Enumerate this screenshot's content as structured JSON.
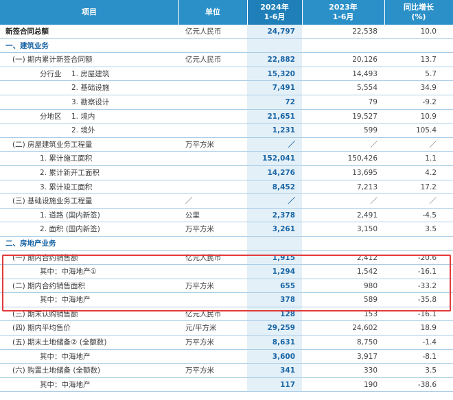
{
  "header": {
    "item": "项目",
    "unit": "单位",
    "y2024_line1": "2024年",
    "y2024_line2": "1-6月",
    "y2023_line1": "2023年",
    "y2023_line2": "1-6月",
    "yoy_line1": "同比增长",
    "yoy_line2": "(%)"
  },
  "rows": [
    {
      "label": "新签合同总额",
      "unit": "亿元人民币",
      "v2024": "24,797",
      "v2023": "22,538",
      "yoy": "10.0"
    },
    {
      "label": "一、建筑业务",
      "unit": "",
      "v2024": "",
      "v2023": "",
      "yoy": ""
    },
    {
      "label": "(一) 期内累计新签合同额",
      "unit": "亿元人民币",
      "v2024": "22,882",
      "v2023": "20,126",
      "yoy": "13.7"
    },
    {
      "label": "1. 房屋建筑",
      "prefix": "分行业",
      "unit": "",
      "v2024": "15,320",
      "v2023": "14,493",
      "yoy": "5.7"
    },
    {
      "label": "2. 基础设施",
      "unit": "",
      "v2024": "7,491",
      "v2023": "5,554",
      "yoy": "34.9"
    },
    {
      "label": "3. 勘察设计",
      "unit": "",
      "v2024": "72",
      "v2023": "79",
      "yoy": "-9.2"
    },
    {
      "label": "1. 境内",
      "prefix": "分地区",
      "unit": "",
      "v2024": "21,651",
      "v2023": "19,527",
      "yoy": "10.9"
    },
    {
      "label": "2. 境外",
      "unit": "",
      "v2024": "1,231",
      "v2023": "599",
      "yoy": "105.4"
    },
    {
      "label": "(二) 房屋建筑业务工程量",
      "unit": "万平方米",
      "v2024": "／",
      "v2023": "／",
      "yoy": "／"
    },
    {
      "label": "1. 累计施工面积",
      "unit": "",
      "v2024": "152,041",
      "v2023": "150,426",
      "yoy": "1.1"
    },
    {
      "label": "2. 累计新开工面积",
      "unit": "",
      "v2024": "14,276",
      "v2023": "13,695",
      "yoy": "4.2"
    },
    {
      "label": "3. 累计竣工面积",
      "unit": "",
      "v2024": "8,452",
      "v2023": "7,213",
      "yoy": "17.2"
    },
    {
      "label": "(三) 基础设施业务工程量",
      "unit": "／",
      "v2024": "／",
      "v2023": "／",
      "yoy": "／"
    },
    {
      "label": "1. 道路 (国内新签)",
      "unit": "公里",
      "v2024": "2,378",
      "v2023": "2,491",
      "yoy": "-4.5"
    },
    {
      "label": "2. 面积 (国内新签)",
      "unit": "万平方米",
      "v2024": "3,261",
      "v2023": "3,150",
      "yoy": "3.5"
    },
    {
      "label": "二、房地产业务",
      "unit": "",
      "v2024": "",
      "v2023": "",
      "yoy": ""
    },
    {
      "label": "(一) 期内合约销售额",
      "unit": "亿元人民币",
      "v2024": "1,915",
      "v2023": "2,412",
      "yoy": "-20.6"
    },
    {
      "label": "其中：中海地产①",
      "unit": "",
      "v2024": "1,294",
      "v2023": "1,542",
      "yoy": "-16.1"
    },
    {
      "label": "(二) 期内合约销售面积",
      "unit": "万平方米",
      "v2024": "655",
      "v2023": "980",
      "yoy": "-33.2"
    },
    {
      "label": "其中：中海地产",
      "unit": "",
      "v2024": "378",
      "v2023": "589",
      "yoy": "-35.8"
    },
    {
      "label": "(三) 期末认购销售额",
      "unit": "亿元人民币",
      "v2024": "128",
      "v2023": "153",
      "yoy": "-16.1"
    },
    {
      "label": "(四) 期内平均售价",
      "unit": "元/平方米",
      "v2024": "29,259",
      "v2023": "24,602",
      "yoy": "18.9"
    },
    {
      "label": "(五) 期末土地储备② (全额数)",
      "unit": "万平方米",
      "v2024": "8,631",
      "v2023": "8,750",
      "yoy": "-1.4"
    },
    {
      "label": "其中：中海地产",
      "unit": "",
      "v2024": "3,600",
      "v2023": "3,917",
      "yoy": "-8.1"
    },
    {
      "label": "(六) 购置土地储备 (全额数)",
      "unit": "万平方米",
      "v2024": "341",
      "v2023": "330",
      "yoy": "3.5"
    },
    {
      "label": "其中：中海地产",
      "unit": "",
      "v2024": "117",
      "v2023": "190",
      "yoy": "-38.6"
    }
  ],
  "colors": {
    "header_bg": "#2b90c8",
    "highlight_2024_col": "#e4f0f8",
    "value_blue": "#1a66a6",
    "annotation_box": "#e23a3a"
  }
}
